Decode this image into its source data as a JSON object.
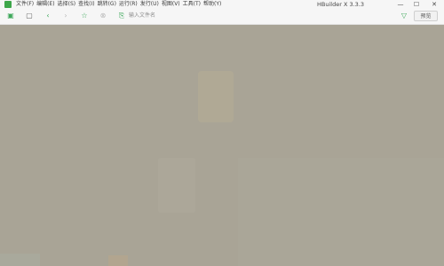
{
  "menu": [
    "文件(F)",
    "编辑(E)",
    "选择(S)",
    "查找(I)",
    "跳转(G)",
    "运行(R)",
    "发行(U)",
    "视图(V)",
    "工具(T)",
    "帮助(Y)"
  ],
  "window": {
    "title": "HBuilder X 3.3.3"
  },
  "toolbar": {
    "search_placeholder": "输入文件名",
    "search_button": "预览"
  },
  "colors": {
    "accent": "#3ea85a",
    "overlay": "#9a9480"
  }
}
